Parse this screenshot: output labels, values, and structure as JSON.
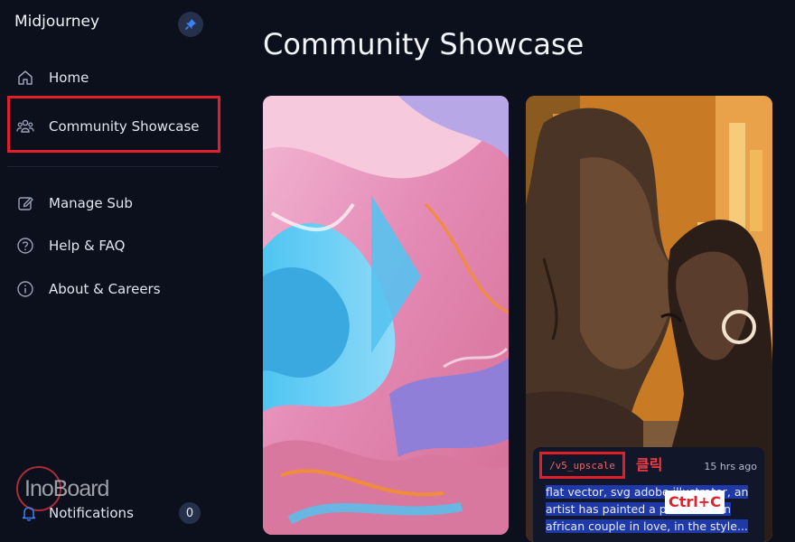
{
  "app": {
    "title": "Midjourney"
  },
  "sidebar": {
    "items": [
      {
        "label": "Home",
        "icon": "home-icon"
      },
      {
        "label": "Community Showcase",
        "icon": "people-icon"
      },
      {
        "label": "Manage Sub",
        "icon": "edit-icon"
      },
      {
        "label": "Help & FAQ",
        "icon": "help-icon"
      },
      {
        "label": "About & Careers",
        "icon": "info-icon"
      }
    ],
    "notifications": {
      "label": "Notifications",
      "count": "0"
    }
  },
  "watermark": {
    "text": "InoBoard"
  },
  "main": {
    "title": "Community Showcase",
    "cards": [
      {
        "image": "abstract-glossy-swirl"
      },
      {
        "image": "kissing-couple-illustration",
        "command": "/v5_upscale",
        "time": "15 hrs ago",
        "prompt": "flat vector, svg adobe illustrator, an artist has painted a picture of an african couple in love, in the style..."
      }
    ]
  },
  "annotations": {
    "click_note": "클릭",
    "copy_note": "Ctrl+C"
  },
  "colors": {
    "background": "#0c0f1c",
    "highlight": "#e01f2b",
    "selection": "#1f3aa8"
  }
}
